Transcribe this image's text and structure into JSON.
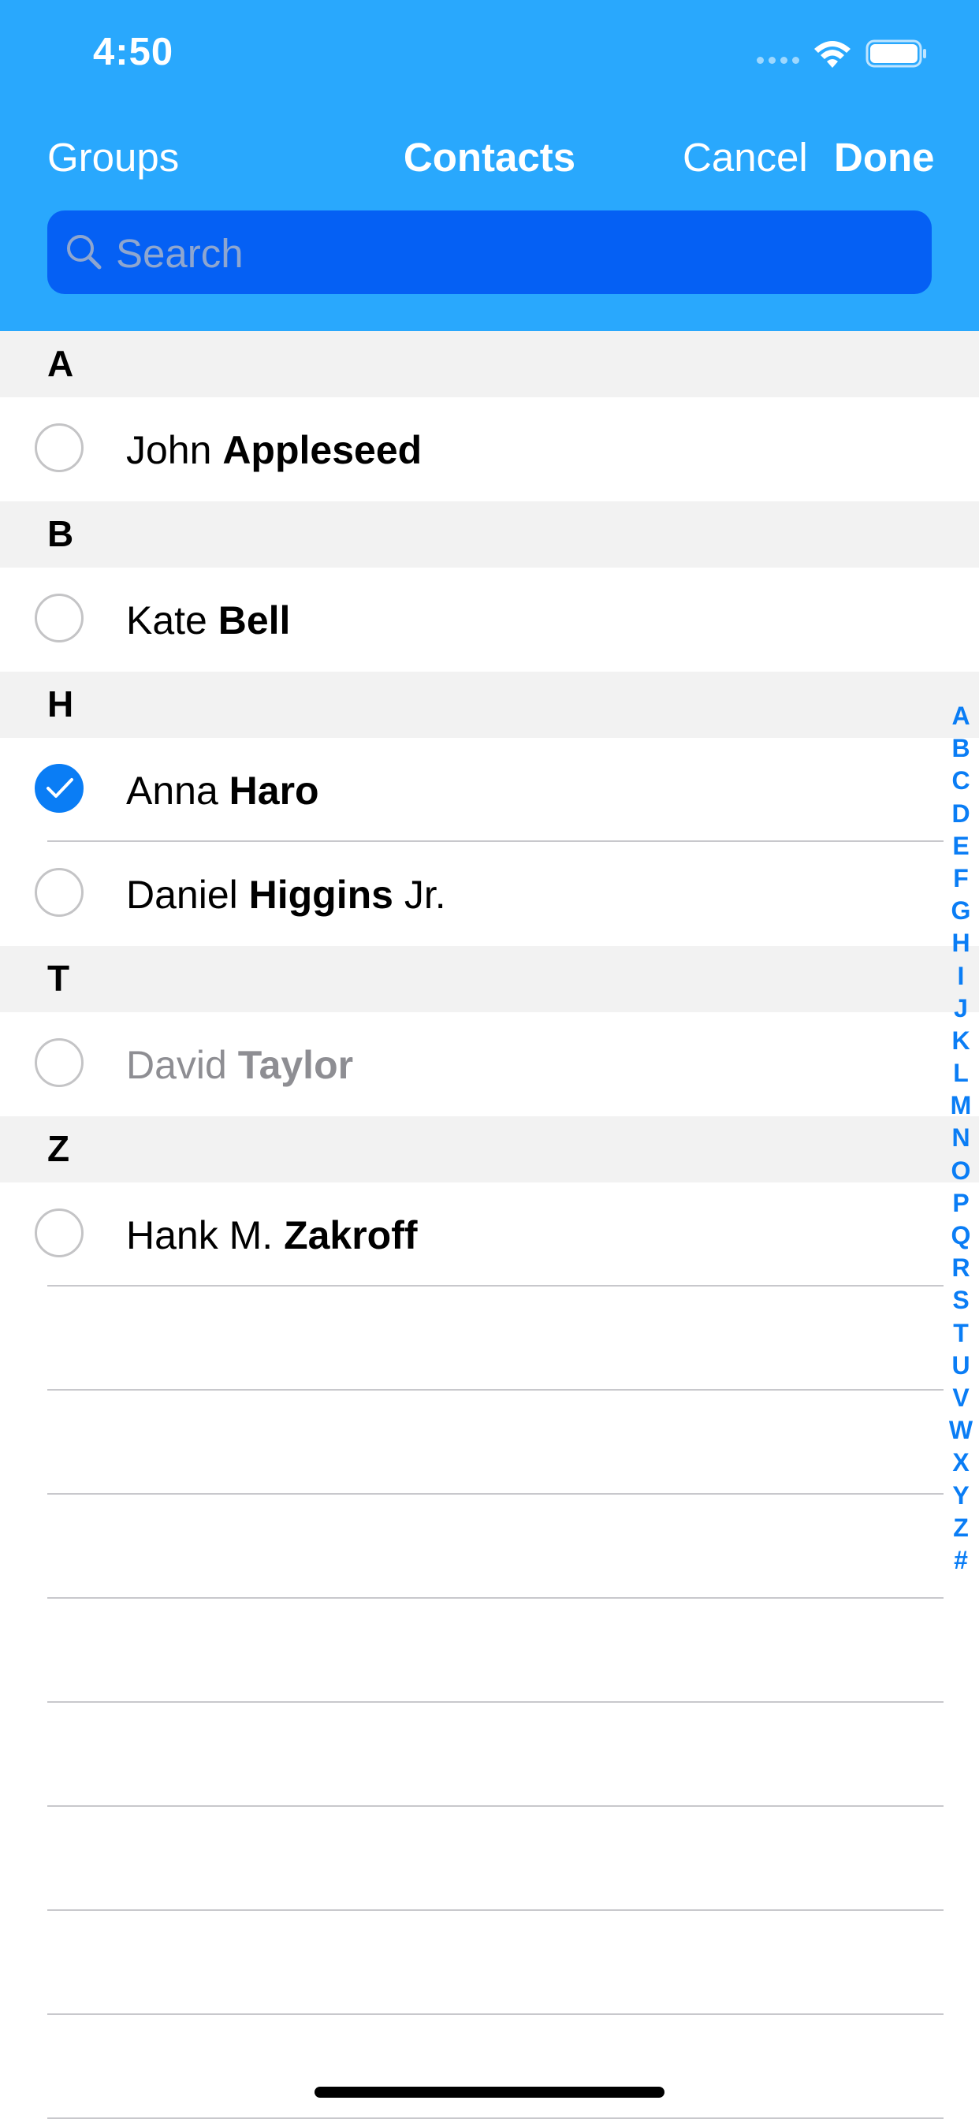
{
  "status_bar": {
    "time": "4:50"
  },
  "nav": {
    "left": "Groups",
    "title": "Contacts",
    "cancel": "Cancel",
    "done": "Done"
  },
  "search": {
    "placeholder": "Search",
    "value": ""
  },
  "sections": [
    {
      "letter": "A",
      "contacts": [
        {
          "first": "John ",
          "last": "Appleseed",
          "suffix": "",
          "selected": false,
          "disabled": false
        }
      ]
    },
    {
      "letter": "B",
      "contacts": [
        {
          "first": "Kate ",
          "last": "Bell",
          "suffix": "",
          "selected": false,
          "disabled": false
        }
      ]
    },
    {
      "letter": "H",
      "contacts": [
        {
          "first": "Anna ",
          "last": "Haro",
          "suffix": "",
          "selected": true,
          "disabled": false
        },
        {
          "first": "Daniel ",
          "last": "Higgins",
          "suffix": " Jr.",
          "selected": false,
          "disabled": false
        }
      ]
    },
    {
      "letter": "T",
      "contacts": [
        {
          "first": "David ",
          "last": "Taylor",
          "suffix": "",
          "selected": false,
          "disabled": true
        }
      ]
    },
    {
      "letter": "Z",
      "contacts": [
        {
          "first": "Hank M. ",
          "last": "Zakroff",
          "suffix": "",
          "selected": false,
          "disabled": false
        }
      ]
    }
  ],
  "index": [
    "A",
    "B",
    "C",
    "D",
    "E",
    "F",
    "G",
    "H",
    "I",
    "J",
    "K",
    "L",
    "M",
    "N",
    "O",
    "P",
    "Q",
    "R",
    "S",
    "T",
    "U",
    "V",
    "W",
    "X",
    "Y",
    "Z",
    "#"
  ],
  "colors": {
    "header_bg": "#29a8fd",
    "search_bg": "#0560f4",
    "accent": "#0a7df5",
    "section_bg": "#f2f2f2"
  }
}
